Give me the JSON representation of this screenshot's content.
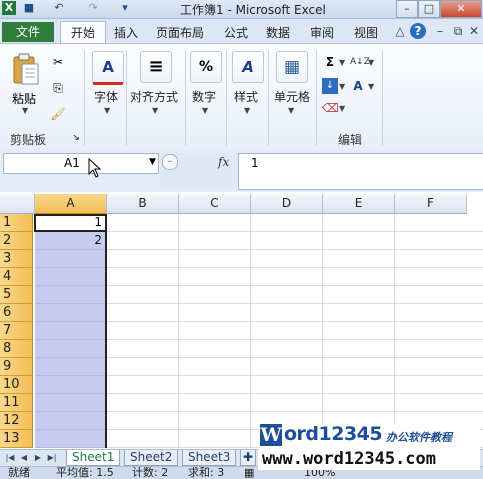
{
  "title_bar": {
    "title": "工作簿1 - Microsoft Excel",
    "quick_access": [
      "excel-logo-icon",
      "save-icon",
      "undo-icon",
      "redo-icon",
      "customize-icon"
    ]
  },
  "tabs": {
    "file": "文件",
    "items": [
      "开始",
      "插入",
      "页面布局",
      "公式",
      "数据",
      "审阅",
      "视图"
    ],
    "active": "开始"
  },
  "ribbon": {
    "clipboard": {
      "paste_label": "粘贴",
      "group_name": "剪贴板"
    },
    "buttons": [
      {
        "label": "字体",
        "icon_text": "A"
      },
      {
        "label": "对齐方式",
        "icon_text": "≡"
      },
      {
        "label": "数字",
        "icon_text": "%"
      },
      {
        "label": "样式",
        "icon_text": "A"
      },
      {
        "label": "单元格",
        "icon_text": "▦"
      }
    ],
    "editing": {
      "group_name": "编辑",
      "sum_icon": "Σ",
      "sort_icon": "A↓Z",
      "find_icon": "A"
    }
  },
  "formula_bar": {
    "name_box": "A1",
    "fx_label": "fx",
    "formula": "1"
  },
  "grid": {
    "columns": [
      "A",
      "B",
      "C",
      "D",
      "E",
      "F"
    ],
    "selected_column": "A",
    "rows": [
      "1",
      "2",
      "3",
      "4",
      "5",
      "6",
      "7",
      "8",
      "9",
      "10",
      "11",
      "12",
      "13"
    ],
    "cells_a": [
      "1",
      "2",
      "",
      "",
      "",
      "",
      "",
      "",
      "",
      "",
      "",
      "",
      ""
    ]
  },
  "sheets": [
    "Sheet1",
    "Sheet2",
    "Sheet3"
  ],
  "status_bar": {
    "ready": "就绪",
    "average": "平均值: 1.5",
    "count": "计数: 2",
    "sum": "求和: 3",
    "zoom": "100%"
  },
  "watermark": {
    "brand": "ord12345",
    "brand_initial": "W",
    "subtitle": "办公软件教程",
    "url": "www.word12345.com"
  },
  "colors": {
    "file_tab": "#2f7c3b",
    "selection": "#c5ccee",
    "header_highlight": "#f2bd55",
    "brand": "#1c4e9b"
  }
}
